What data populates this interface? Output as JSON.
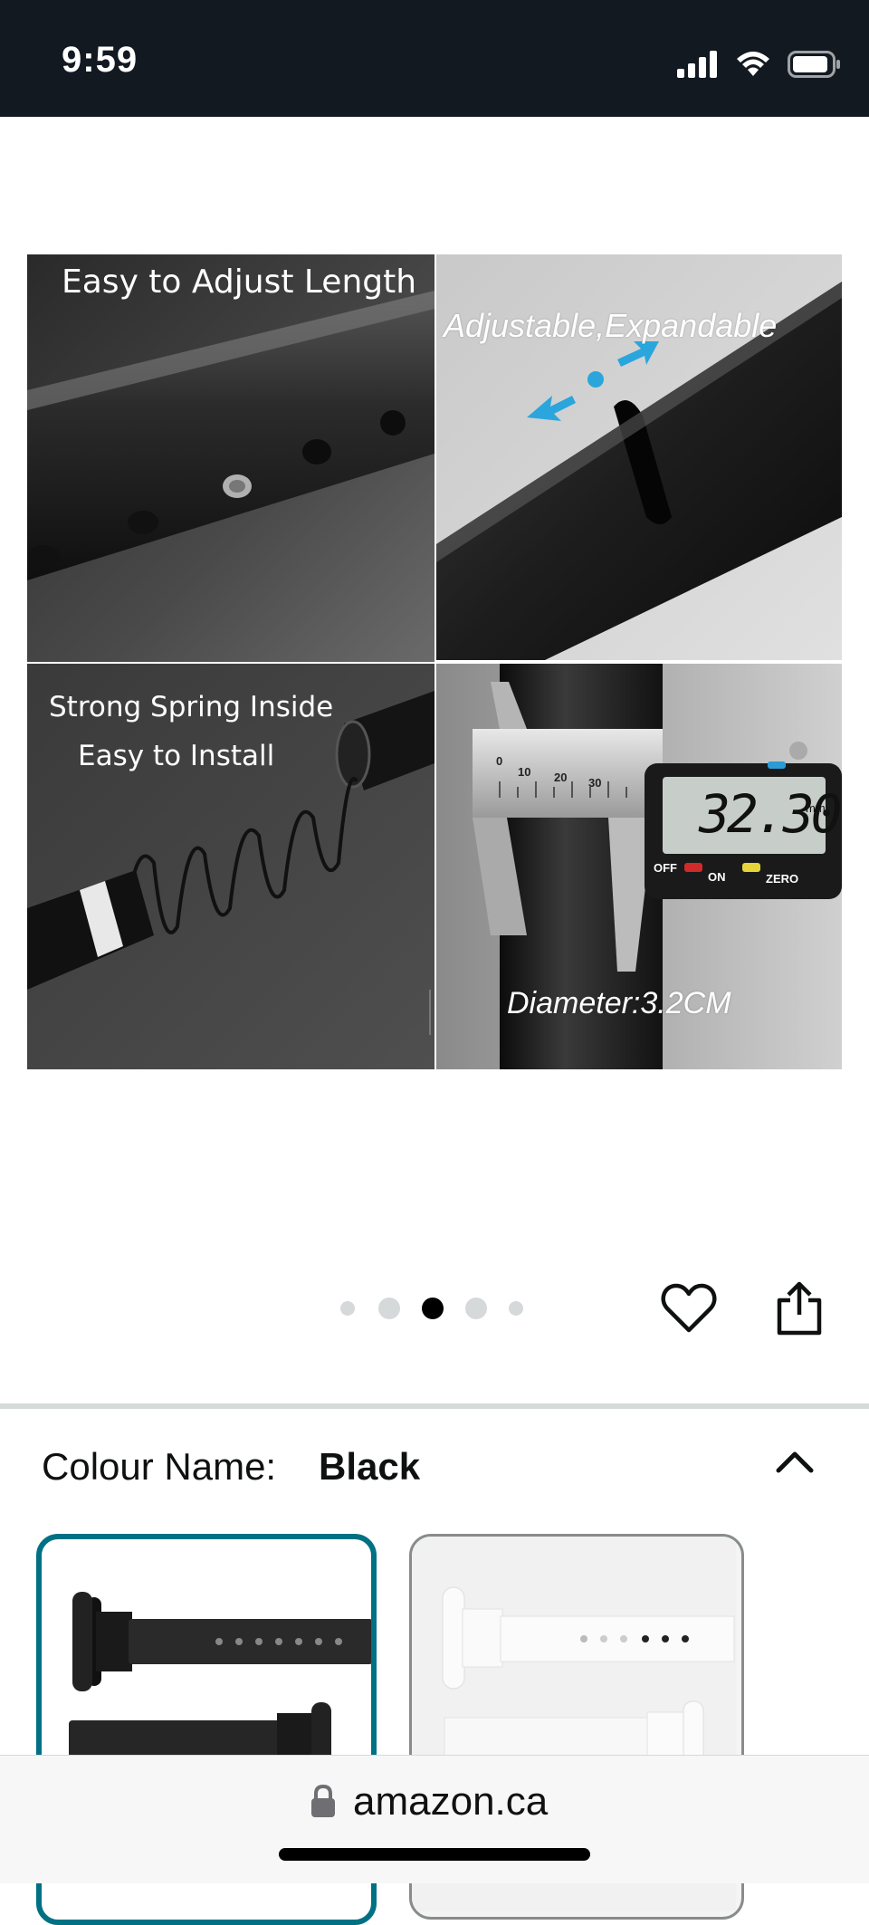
{
  "status_bar": {
    "time": "9:59"
  },
  "gallery": {
    "captions": {
      "adjust_length": "Easy to Adjust Length",
      "adjustable": "Adjustable,Expandable",
      "spring_line1": "Strong Spring Inside",
      "spring_line2": "Easy to Install",
      "diameter": "Diameter:3.2CM"
    },
    "caliper": {
      "readout": "32.30",
      "unit": "mm",
      "off_label": "OFF",
      "on_label": "ON",
      "zero_label": "ZERO",
      "scale_numbers": [
        "0",
        "10",
        "20",
        "30"
      ]
    },
    "image_count": 5,
    "current_index": 3
  },
  "actions": {
    "wishlist_icon": "heart-icon",
    "share_icon": "share-icon"
  },
  "colour": {
    "label": "Colour Name:",
    "value": "Black",
    "toggle_icon": "chevron-up-icon",
    "swatches": [
      {
        "color": "Black",
        "selected": true
      },
      {
        "color": "White",
        "selected": false
      }
    ]
  },
  "browser": {
    "url": "amazon.ca",
    "lock_icon": "lock-icon"
  },
  "theme": {
    "header_bg": "#131921",
    "selected_border": "#007185",
    "arrow_blue": "#2aa6dd"
  }
}
